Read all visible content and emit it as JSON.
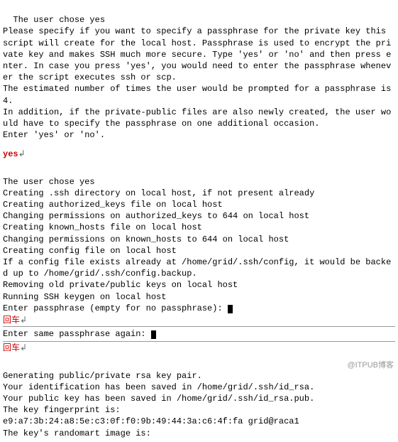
{
  "para1": {
    "line1": "The user chose yes",
    "line2": "Please specify if you want to specify a passphrase for the private key this script will create for the local host. Passphrase is used to encrypt the private key and makes SSH much more secure. Type 'yes' or 'no' and then press enter. In case you press 'yes', you would need to enter the passphrase whenever the script executes ssh or scp.",
    "line3": "The estimated number of times the user would be prompted for a passphrase is 4.",
    "line4": "In addition, if the private-public files are also newly created, the user would have to specify the passphrase on one additional occasion.",
    "line5": "Enter 'yes' or 'no'."
  },
  "input1": "yes",
  "para2": {
    "l1": "The user chose yes",
    "l2": "Creating .ssh directory on local host, if not present already",
    "l3": "Creating authorized_keys file on local host",
    "l4": "Changing permissions on authorized_keys to 644 on local host",
    "l5": "Creating known_hosts file on local host",
    "l6": "Changing permissions on known_hosts to 644 on local host",
    "l7": "Creating config file on local host",
    "l8": "If a config file exists already at /home/grid/.ssh/config, it would be backed up to /home/grid/.ssh/config.backup.",
    "l9": "Removing old private/public keys on local host",
    "l10": "Running SSH keygen on local host",
    "l11": "Enter passphrase (empty for no passphrase): "
  },
  "ann1": "回车",
  "prompt2": "Enter same passphrase again: ",
  "ann2": "回车",
  "para3": {
    "l1": "Generating public/private rsa key pair.",
    "l2": "Your identification has been saved in /home/grid/.ssh/id_rsa.",
    "l3": "Your public key has been saved in /home/grid/.ssh/id_rsa.pub.",
    "l4": "The key fingerprint is:",
    "l5": "e9:a7:3b:24:a8:5e:c3:0f:f0:9b:49:44:3a:c6:4f:fa grid@raca1",
    "l6": "The key's randomart image is:"
  },
  "arrow": "↲",
  "watermark": "@ITPUB博客"
}
